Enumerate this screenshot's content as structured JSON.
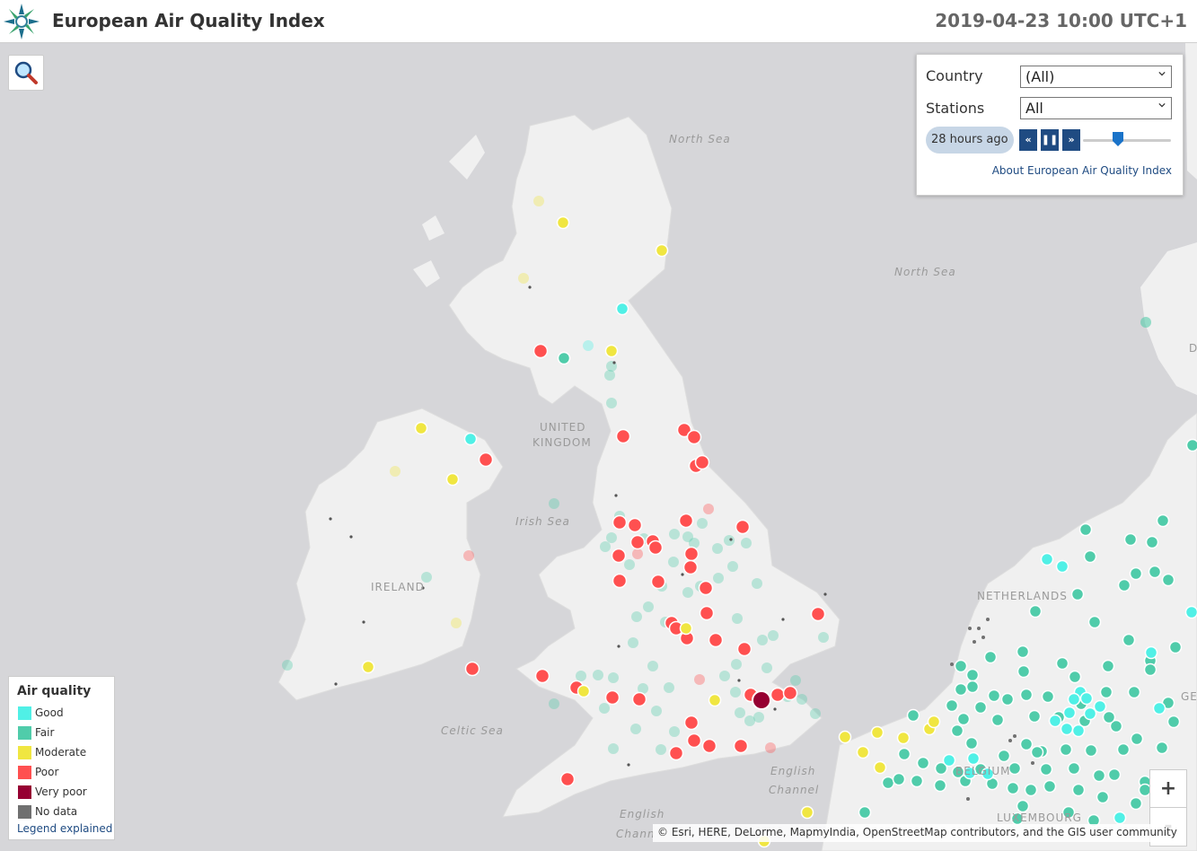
{
  "header": {
    "title": "European Air Quality Index",
    "timestamp": "2019-04-23 10:00 UTC+1"
  },
  "controls": {
    "country_label": "Country",
    "country_value": "(All)",
    "stations_label": "Stations",
    "stations_value": "All",
    "hours_ago": "28 hours ago",
    "rewind_label": "«",
    "pause_label": "❚❚",
    "forward_label": "»",
    "about_link": "About European Air Quality Index"
  },
  "legend": {
    "title": "Air quality",
    "items": [
      {
        "label": "Good",
        "color": "#50f0e6"
      },
      {
        "label": "Fair",
        "color": "#50ccaa"
      },
      {
        "label": "Moderate",
        "color": "#f0e641"
      },
      {
        "label": "Poor",
        "color": "#ff5050"
      },
      {
        "label": "Very poor",
        "color": "#960032"
      },
      {
        "label": "No data",
        "color": "#707070"
      }
    ],
    "link": "Legend explained"
  },
  "map_labels": {
    "north_sea_1": "North Sea",
    "north_sea_2": "North Sea",
    "united": "UNITED",
    "kingdom": "KINGDOM",
    "irish_sea": "Irish Sea",
    "ireland": "IRELAND",
    "celtic_sea": "Celtic Sea",
    "english_channel_1": "English",
    "english_channel_2": "Channel",
    "english_channel_3": "English",
    "english_channel_4": "Chann",
    "netherlands": "NETHERLANDS",
    "belgium": "BELGIUM",
    "luxembourg": "LUXEMBOURG",
    "d_label": "D",
    "ge_label": "GE"
  },
  "zoom": {
    "in": "+",
    "out": "-"
  },
  "attribution": "© Esri, HERE, DeLorme, MapmyIndia, OpenStreetMap contributors, and the GIS user community"
}
